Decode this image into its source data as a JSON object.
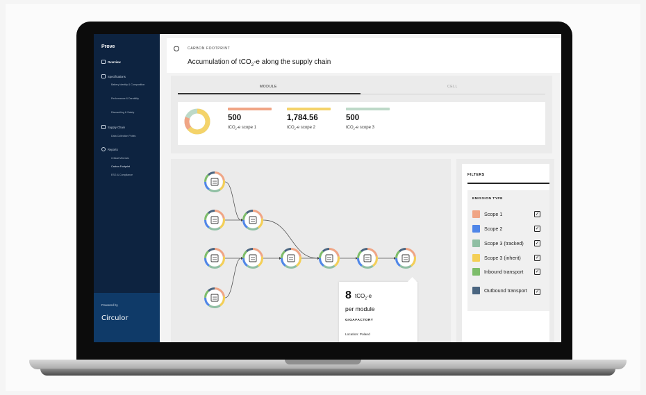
{
  "sidebar": {
    "brand": "Prove",
    "items": [
      {
        "label": "Overview",
        "icon": "grid-icon"
      },
      {
        "label": "Specifications",
        "icon": "document-icon",
        "subs": [
          "Battery Identity & Composition",
          "Performance & Durability",
          "Dismantling & Safety"
        ]
      },
      {
        "label": "Supply Chain",
        "icon": "map-icon",
        "subs": [
          "Data Collection Points"
        ]
      },
      {
        "label": "Reports",
        "icon": "chart-icon",
        "subs": [
          "Critical Minerals",
          "Carbon Footprint",
          "ESG & Compliance"
        ]
      }
    ],
    "powered_by": "Powered by",
    "logo_text": "Circulor"
  },
  "header": {
    "section_label": "CARBON FOOTPRINT",
    "title_prefix": "Accumulation of tCO",
    "title_sub": "2",
    "title_suffix": "-e along the supply chain"
  },
  "tabs": [
    {
      "label": "MODULE",
      "active": true
    },
    {
      "label": "CELL",
      "active": false
    }
  ],
  "metrics": [
    {
      "value": "500",
      "unit": "tCO",
      "sub": "2",
      "suffix": "-e scope 1",
      "color": "#f0a585"
    },
    {
      "value": "1,784.56",
      "unit": "tCO",
      "sub": "2",
      "suffix": "-e scope 2",
      "color": "#f4d36a"
    },
    {
      "value": "500",
      "unit": "tCO",
      "sub": "2",
      "suffix": "-e scope 3",
      "color": "#bdd9c8"
    }
  ],
  "tooltip": {
    "value": "8",
    "unit": "tCO",
    "unit_sub": "2",
    "unit_suffix": "-e",
    "per": "per module",
    "site": "GIGAFACTORY",
    "location": "Location: Poland"
  },
  "filters": {
    "title": "FILTERS",
    "group": "EMISSION TYPE",
    "items": [
      {
        "label": "Scope 1",
        "color": "#f0a585",
        "checked": true
      },
      {
        "label": "Scope 2",
        "color": "#4f86e8",
        "checked": true
      },
      {
        "label": "Scope 3 (tracked)",
        "color": "#8fbfa3",
        "checked": true
      },
      {
        "label": "Scope 3 (inherit)",
        "color": "#f4cf56",
        "checked": true
      },
      {
        "label": "Inbound transport",
        "color": "#7dbd6a",
        "checked": true
      },
      {
        "label": "Outbound transport",
        "color": "#4a6580",
        "checked": true
      }
    ],
    "check_glyph": "✓"
  }
}
